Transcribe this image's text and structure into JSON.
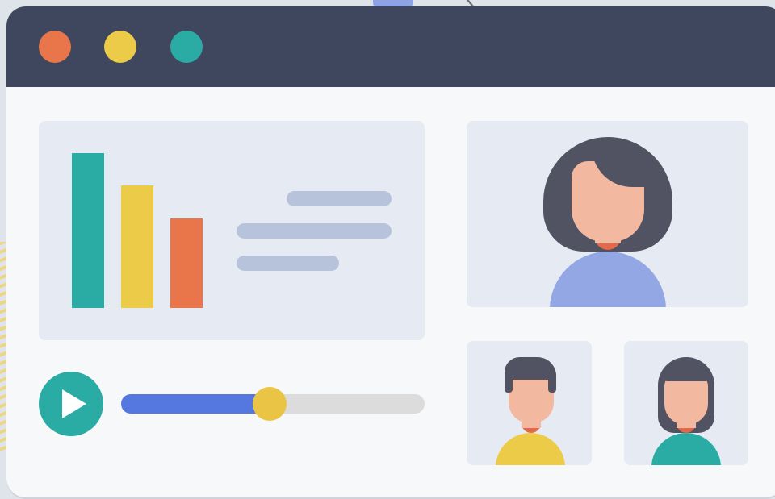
{
  "window": {
    "buttons": [
      {
        "name": "close",
        "color": "#e9764a"
      },
      {
        "name": "minimize",
        "color": "#eccb48"
      },
      {
        "name": "maximize",
        "color": "#2aaca5"
      }
    ],
    "titlebar_color": "#3f475f"
  },
  "chart_panel": {
    "bars": [
      {
        "value": 1.0,
        "color": "#2aaca5"
      },
      {
        "value": 0.79,
        "color": "#eccb48"
      },
      {
        "value": 0.58,
        "color": "#e9764a"
      }
    ],
    "placeholder_line_color": "#b7c3da"
  },
  "player": {
    "icon": "play-icon",
    "progress": 0.49,
    "progress_color": "#5477e0",
    "knob_color": "#eac444"
  },
  "participants": [
    {
      "role": "host",
      "shirt_color": "#93a7e4"
    },
    {
      "role": "guest",
      "shirt_color": "#eccb48"
    },
    {
      "role": "guest",
      "shirt_color": "#2aaca5"
    }
  ]
}
